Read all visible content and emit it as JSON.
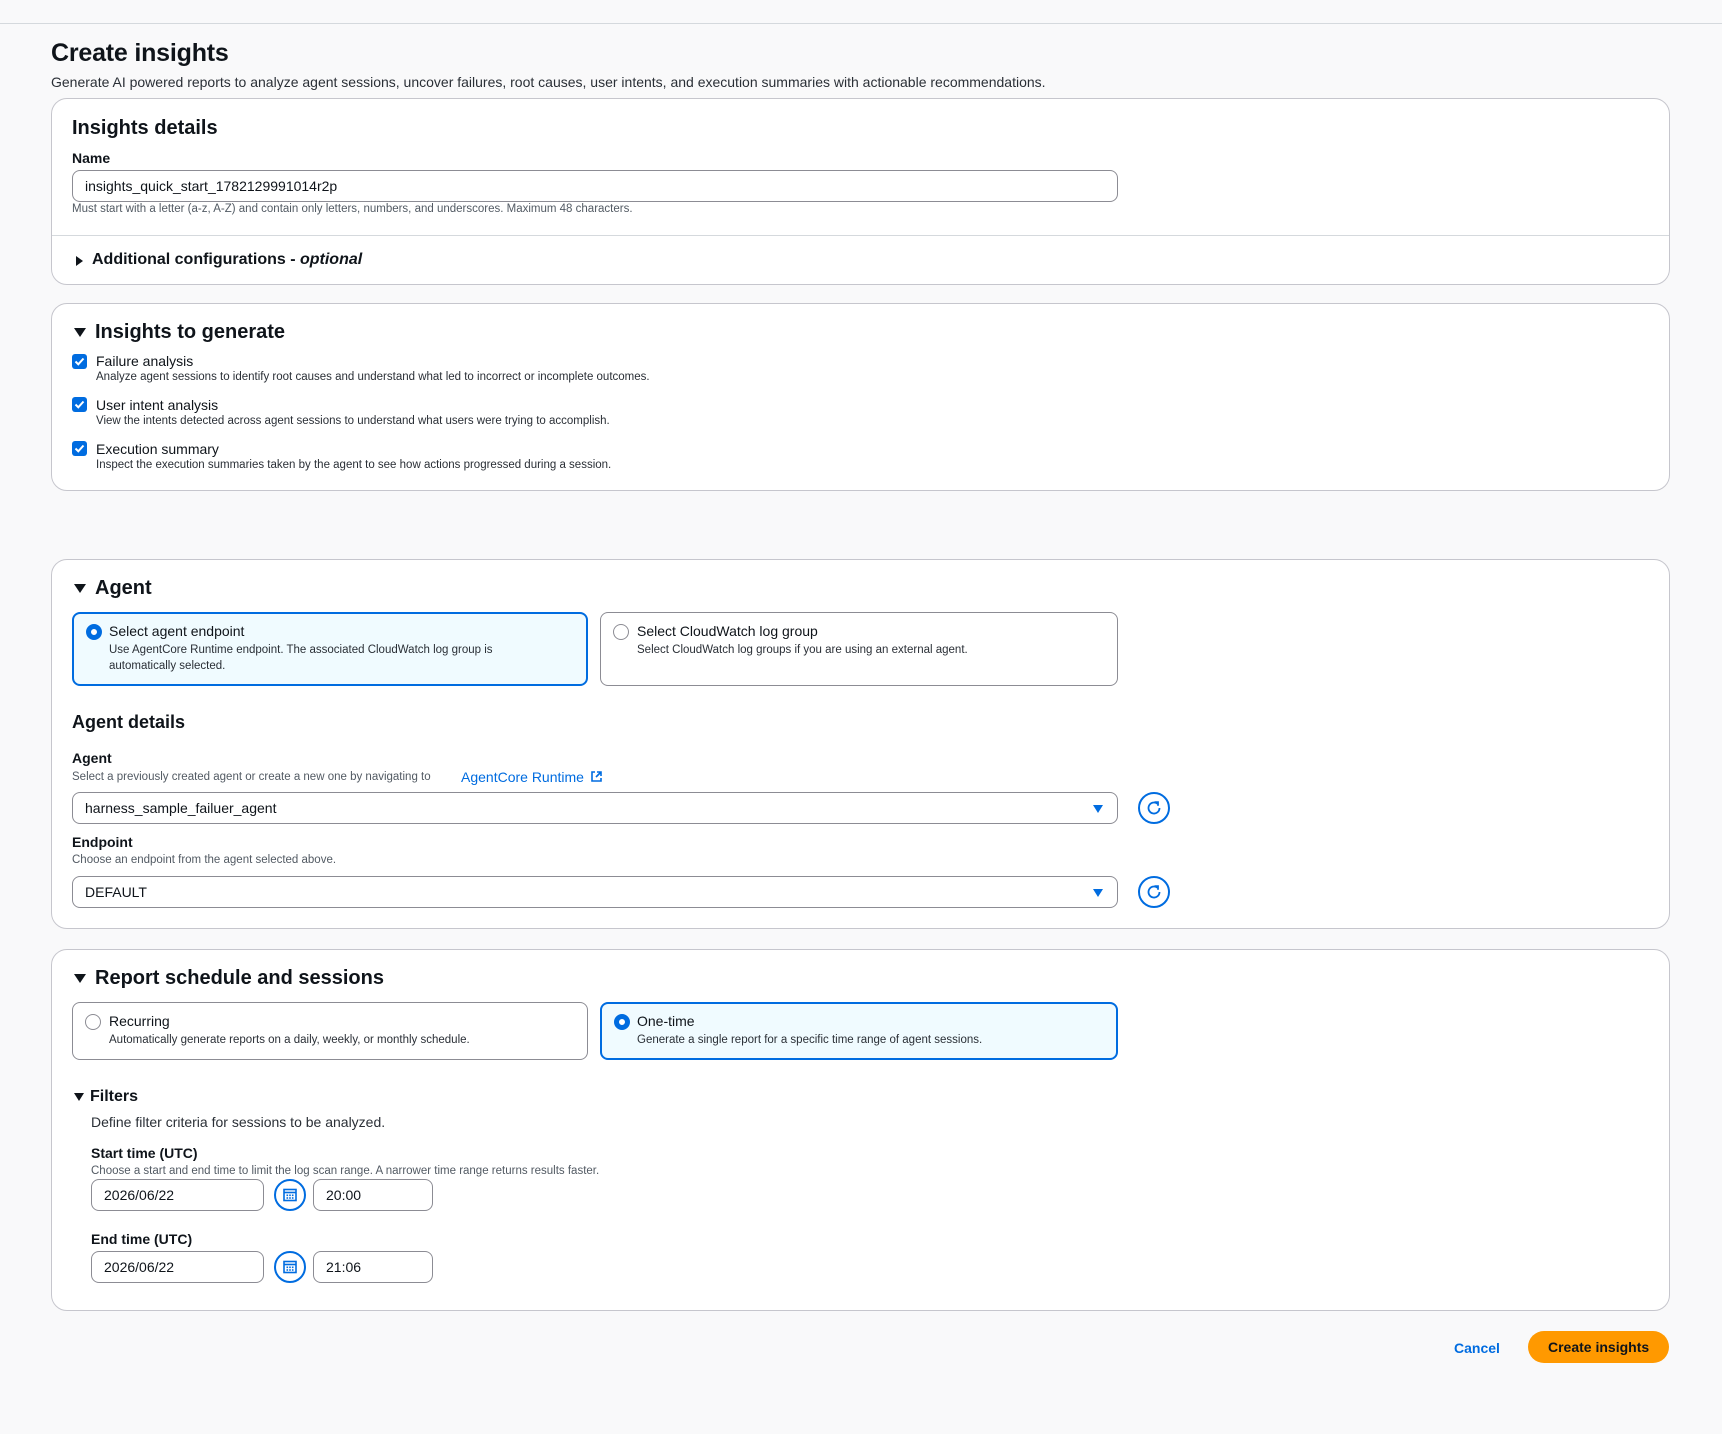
{
  "page": {
    "title": "Create insights",
    "description": "Generate AI powered reports to analyze agent sessions, uncover failures, root causes, user intents, and execution summaries with actionable recommendations."
  },
  "insights_details": {
    "title": "Insights details",
    "name_label": "Name",
    "name_value": "insights_quick_start_1782129991014r2p",
    "name_hint": "Must start with a letter (a-z, A-Z) and contain only letters, numbers, and underscores. Maximum 48 characters.",
    "additional_label": "Additional configurations - ",
    "additional_optional": "optional"
  },
  "insights_to_generate": {
    "title": "Insights to generate",
    "items": [
      {
        "label": "Failure analysis",
        "description": "Analyze agent sessions to identify root causes and understand what led to incorrect or incomplete outcomes.",
        "checked": true
      },
      {
        "label": "User intent analysis",
        "description": "View the intents detected across agent sessions to understand what users were trying to accomplish.",
        "checked": true
      },
      {
        "label": "Execution summary",
        "description": "Inspect the execution summaries taken by the agent to see how actions progressed during a session.",
        "checked": true
      }
    ]
  },
  "agent": {
    "title": "Agent",
    "options": [
      {
        "label": "Select agent endpoint",
        "description": "Use AgentCore Runtime endpoint. The associated CloudWatch log group is automatically selected.",
        "selected": true
      },
      {
        "label": "Select CloudWatch log group",
        "description": "Select CloudWatch log groups if you are using an external agent.",
        "selected": false
      }
    ],
    "details_title": "Agent details",
    "agent_label": "Agent",
    "agent_hint": "Select a previously created agent or create a new one by navigating to",
    "agent_link": "AgentCore Runtime",
    "agent_value": "harness_sample_failuer_agent",
    "endpoint_label": "Endpoint",
    "endpoint_hint": "Choose an endpoint from the agent selected above.",
    "endpoint_value": "DEFAULT"
  },
  "schedule": {
    "title": "Report schedule and sessions",
    "options": [
      {
        "label": "Recurring",
        "description": "Automatically generate reports on a daily, weekly, or monthly schedule.",
        "selected": false
      },
      {
        "label": "One-time",
        "description": "Generate a single report for a specific time range of agent sessions.",
        "selected": true
      }
    ],
    "filters_title": "Filters",
    "filters_description": "Define filter criteria for sessions to be analyzed.",
    "start_label": "Start time (UTC)",
    "start_hint": "Choose a start and end time to limit the log scan range. A narrower time range returns results faster.",
    "start_date": "2026/06/22",
    "start_time": "20:00",
    "end_label": "End time (UTC)",
    "end_date": "2026/06/22",
    "end_time": "21:06"
  },
  "actions": {
    "cancel": "Cancel",
    "create": "Create insights"
  },
  "colors": {
    "accent": "#006ce0",
    "primary_button": "#ff9900",
    "selected_tile_bg": "#f0fbff"
  }
}
